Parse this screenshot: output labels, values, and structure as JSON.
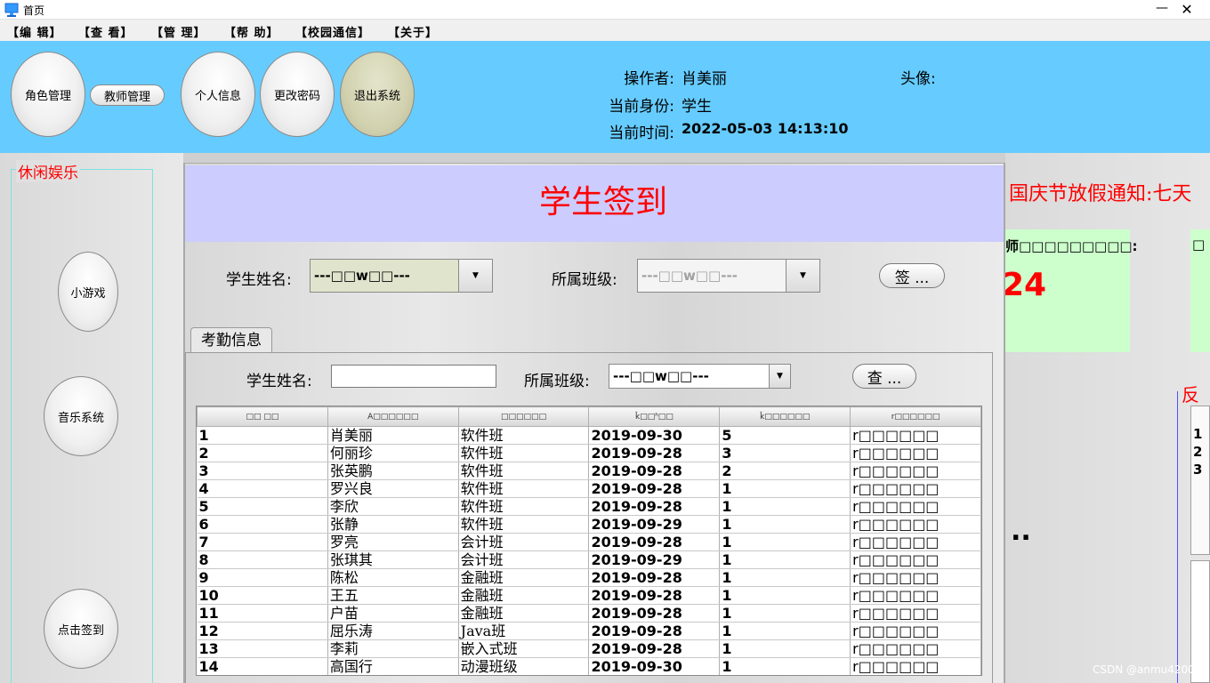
{
  "window": {
    "title": "首页",
    "minimize": "—",
    "close": "✕"
  },
  "menu": [
    "【编 辑】",
    "【查 看】",
    "【管 理】",
    "【帮 助】",
    "【校园通信】",
    "【关于】"
  ],
  "header": {
    "buttons": {
      "roles": "角色管理",
      "teachers": "教师管理",
      "profile": "个人信息",
      "password": "更改密码",
      "logout": "退出系统"
    },
    "operator_label": "操作者:",
    "operator": "肖美丽",
    "identity_label": "当前身份:",
    "identity": "学生",
    "time_label": "当前时间:",
    "time": "2022-05-03 14:13:10",
    "avatar_label": "头像:"
  },
  "left_panel": {
    "title": "休闲娱乐",
    "game": "小游戏",
    "music": "音乐系统",
    "signin": "点击签到"
  },
  "right_panel": {
    "notice": "国庆节放假通知:七天",
    "box_label": "师□□□□□□□□□:",
    "box_count": "24",
    "box2_label": "□",
    "dots": "..",
    "feedback_title": "反",
    "feedback_rows": [
      "1",
      "2",
      "3"
    ]
  },
  "signin_frame": {
    "banner": "学生签到",
    "name_label": "学生姓名:",
    "name_combo": "---□□w□□---",
    "class_label": "所属班级:",
    "class_combo": "---□□w□□---",
    "sign_button": "签 ...",
    "tab": "考勤信息",
    "search_name_label": "学生姓名:",
    "search_name_value": "",
    "search_class_label": "所属班级:",
    "search_class_combo": "---□□w□□---",
    "query_button": "查 ..."
  },
  "table": {
    "columns": [
      "□□ □□",
      "A□□□□□□",
      "□□□□□□",
      "ǩ□□ʱ□□",
      "ǩ□□□□□□",
      "r□□□□□□"
    ],
    "rows": [
      [
        "1",
        "肖美丽",
        "软件班",
        "2019-09-30",
        "5",
        "r□□□□□□"
      ],
      [
        "2",
        "何丽珍",
        "软件班",
        "2019-09-28",
        "3",
        "r□□□□□□"
      ],
      [
        "3",
        "张英鹏",
        "软件班",
        "2019-09-28",
        "2",
        "r□□□□□□"
      ],
      [
        "4",
        "罗兴良",
        "软件班",
        "2019-09-28",
        "1",
        "r□□□□□□"
      ],
      [
        "5",
        "李欣",
        "软件班",
        "2019-09-28",
        "1",
        "r□□□□□□"
      ],
      [
        "6",
        "张静",
        "软件班",
        "2019-09-29",
        "1",
        "r□□□□□□"
      ],
      [
        "7",
        "罗亮",
        "会计班",
        "2019-09-28",
        "1",
        "r□□□□□□"
      ],
      [
        "8",
        "张琪其",
        "会计班",
        "2019-09-29",
        "1",
        "r□□□□□□"
      ],
      [
        "9",
        "陈松",
        "金融班",
        "2019-09-28",
        "1",
        "r□□□□□□"
      ],
      [
        "10",
        "王五",
        "金融班",
        "2019-09-28",
        "1",
        "r□□□□□□"
      ],
      [
        "11",
        "户苗",
        "金融班",
        "2019-09-28",
        "1",
        "r□□□□□□"
      ],
      [
        "12",
        "屈乐涛",
        "Java班",
        "2019-09-28",
        "1",
        "r□□□□□□"
      ],
      [
        "13",
        "李莉",
        "嵌入式班",
        "2019-09-28",
        "1",
        "r□□□□□□"
      ],
      [
        "14",
        "高国行",
        "动漫班级",
        "2019-09-30",
        "1",
        "r□□□□□□"
      ]
    ]
  },
  "watermark": "CSDN @anmu4200",
  "colors": {
    "header_bg": "#66ccff",
    "banner_bg": "#ccccff",
    "accent_red": "#ff0000",
    "green_box": "#ccffcc"
  }
}
